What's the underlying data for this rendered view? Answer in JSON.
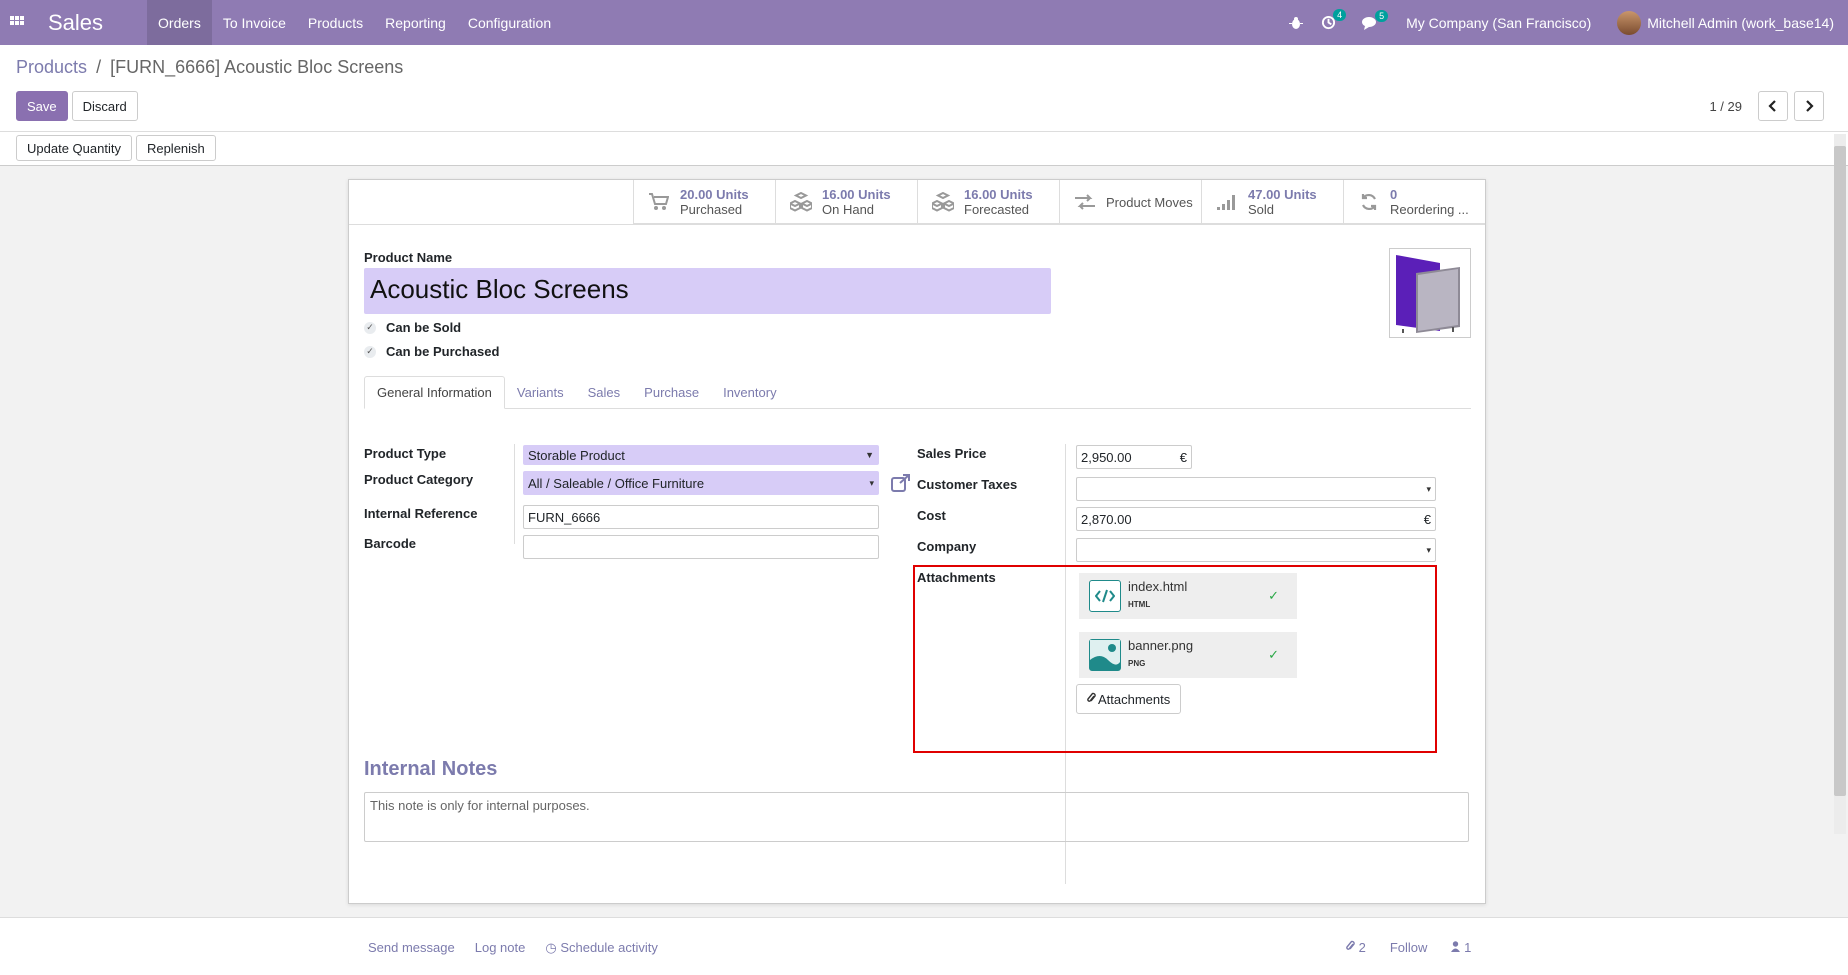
{
  "navbar": {
    "app_name": "Sales",
    "menu": [
      "Orders",
      "To Invoice",
      "Products",
      "Reporting",
      "Configuration"
    ],
    "activities_badge": "4",
    "messages_badge": "5",
    "company": "My Company (San Francisco)",
    "user": "Mitchell Admin (work_base14)"
  },
  "breadcrumb": {
    "parent": "Products",
    "separator": "/",
    "current": "[FURN_6666] Acoustic Bloc Screens"
  },
  "control": {
    "save_label": "Save",
    "discard_label": "Discard",
    "pager": "1 / 29",
    "update_qty_label": "Update Quantity",
    "replenish_label": "Replenish"
  },
  "stats": [
    {
      "value": "20.00 Units",
      "label": "Purchased",
      "icon": "cart-icon"
    },
    {
      "value": "16.00 Units",
      "label": "On Hand",
      "icon": "cubes-icon"
    },
    {
      "value": "16.00 Units",
      "label": "Forecasted",
      "icon": "cubes-icon"
    },
    {
      "value": "",
      "label": "Product Moves",
      "icon": "exchange-icon"
    },
    {
      "value": "47.00 Units",
      "label": "Sold",
      "icon": "signal-icon"
    },
    {
      "value": "0",
      "label": "Reordering ...",
      "icon": "refresh-icon"
    }
  ],
  "product": {
    "name_label": "Product Name",
    "name": "Acoustic Bloc Screens",
    "can_be_sold": "Can be Sold",
    "can_be_purchased": "Can be Purchased"
  },
  "tabs": [
    "General Information",
    "Variants",
    "Sales",
    "Purchase",
    "Inventory"
  ],
  "fields": {
    "product_type_label": "Product Type",
    "product_type": "Storable Product",
    "product_category_label": "Product Category",
    "product_category": "All / Saleable / Office Furniture",
    "internal_ref_label": "Internal Reference",
    "internal_ref": "FURN_6666",
    "barcode_label": "Barcode",
    "barcode": "",
    "sales_price_label": "Sales Price",
    "sales_price": "2,950.00",
    "currency": "€",
    "customer_taxes_label": "Customer Taxes",
    "cost_label": "Cost",
    "cost": "2,870.00",
    "company_label": "Company",
    "attachments_label": "Attachments"
  },
  "attachments": [
    {
      "name": "index.html",
      "ext": "HTML"
    },
    {
      "name": "banner.png",
      "ext": "PNG"
    }
  ],
  "attachments_button": "Attachments",
  "notes": {
    "title": "Internal Notes",
    "placeholder": "This note is only for internal purposes."
  },
  "chatter": {
    "send_message": "Send message",
    "log_note": "Log note",
    "schedule_activity": "Schedule activity",
    "attachments_count": "2",
    "follow": "Follow",
    "followers_count": "1"
  },
  "colors": {
    "navbar": "#8f7bb3",
    "primary": "#8a70b0",
    "link": "#7c7bad",
    "required_bg": "#d7ccf7",
    "highlight_box": "#e00000"
  }
}
